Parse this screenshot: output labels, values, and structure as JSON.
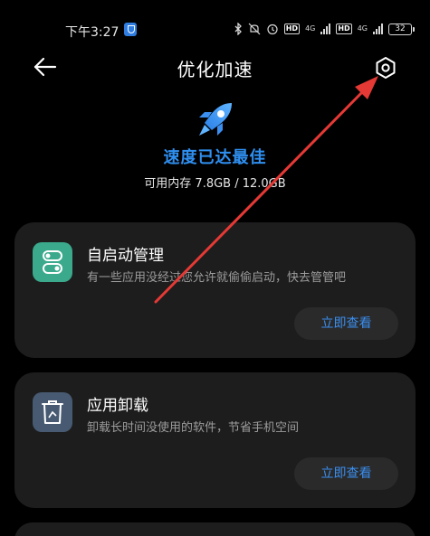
{
  "status_bar": {
    "time": "下午3:27",
    "hd1": "HD",
    "net1": "4G",
    "hd2": "HD",
    "net2": "4G",
    "battery": "32"
  },
  "header": {
    "title": "优化加速",
    "back_icon": "arrow-left-icon",
    "settings_icon": "gear-icon"
  },
  "hero": {
    "icon": "rocket-icon",
    "headline": "速度已达最佳",
    "memory": "可用内存 7.8GB / 12.0GB"
  },
  "cards": [
    {
      "title": "自启动管理",
      "description": "有一些应用没经过您允许就偷偷启动，快去管管吧",
      "action": "立即查看",
      "icon": "autostart-icon",
      "icon_color": "#3aa98c"
    },
    {
      "title": "应用卸载",
      "description": "卸载长时间没使用的软件，节省手机空间",
      "action": "立即查看",
      "icon": "uninstall-icon",
      "icon_color": "#475a72"
    }
  ],
  "colors": {
    "accent": "#2f8ff0",
    "annotation_arrow": "#e53935",
    "card_bg": "#1d1d1d"
  }
}
